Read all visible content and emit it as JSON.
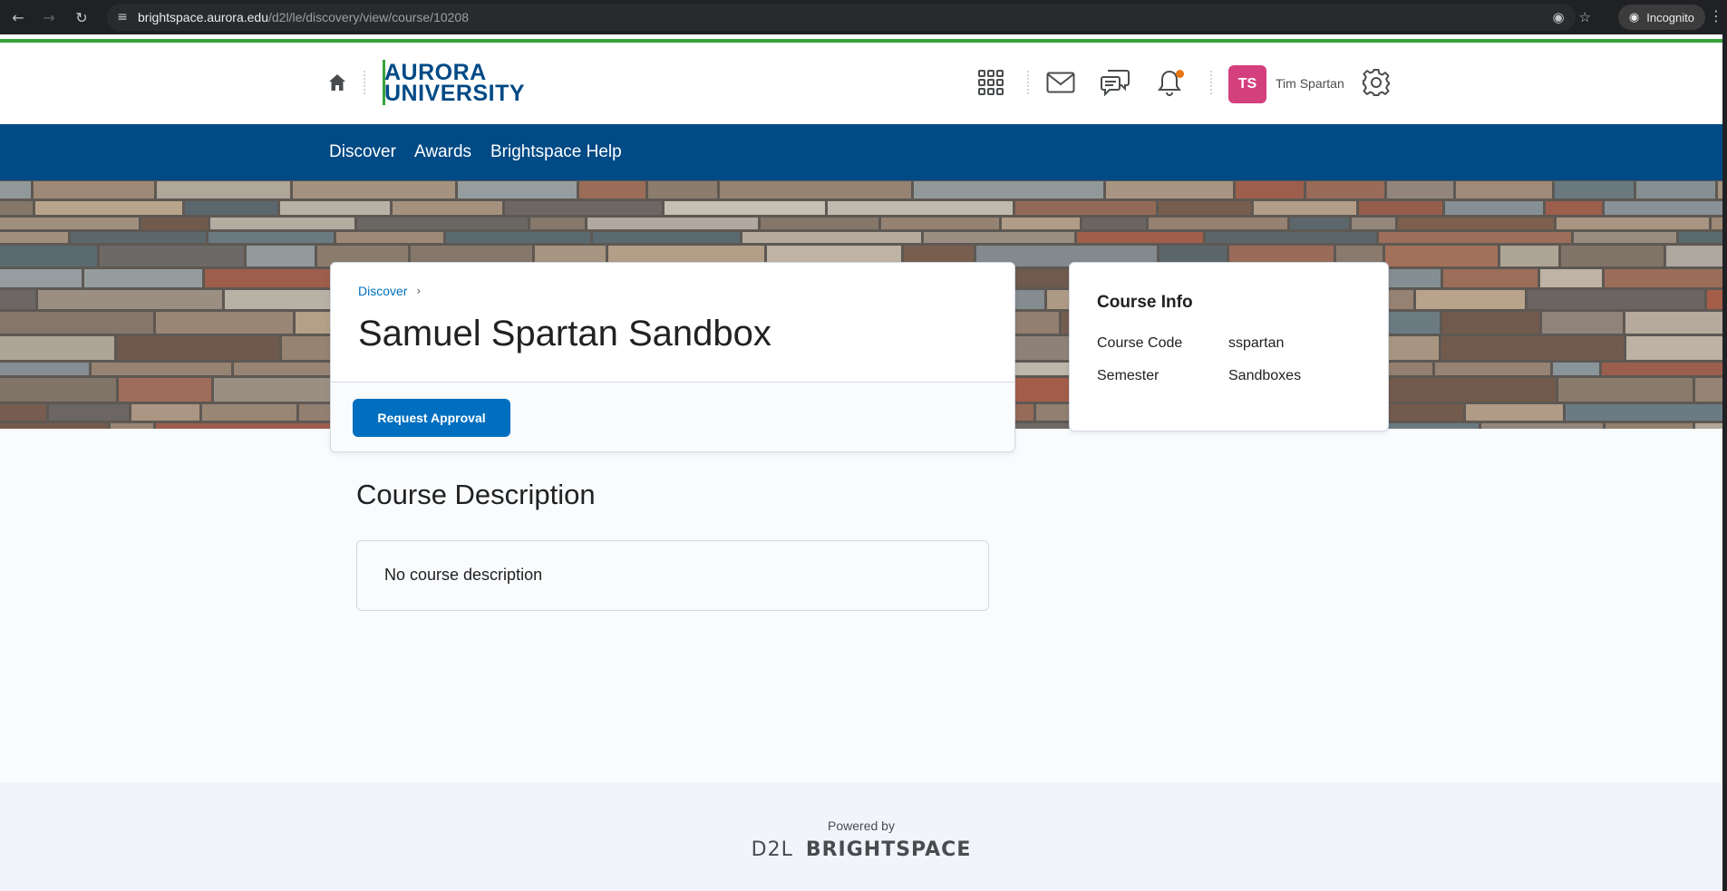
{
  "browser": {
    "url_host": "brightspace.aurora.edu",
    "url_path": "/d2l/le/discovery/view/course/10208",
    "incognito_label": "Incognito"
  },
  "header": {
    "logo_line1": "AURORA",
    "logo_line2": "UNIVERSITY",
    "avatar_initials": "TS",
    "user_name": "Tim Spartan"
  },
  "navbar": {
    "items": [
      "Discover",
      "Awards",
      "Brightspace Help"
    ]
  },
  "course": {
    "breadcrumb": "Discover",
    "title": "Samuel Spartan Sandbox",
    "request_button": "Request Approval"
  },
  "course_info": {
    "heading": "Course Info",
    "rows": [
      {
        "label": "Course Code",
        "value": "sspartan"
      },
      {
        "label": "Semester",
        "value": "Sandboxes"
      }
    ]
  },
  "description": {
    "heading": "Course Description",
    "text": "No course description"
  },
  "footer": {
    "powered_by": "Powered by",
    "brand_d2l": "D2L",
    "brand_name": "BRIGHTSPACE"
  },
  "colors": {
    "primary_blue": "#004a85",
    "button_blue": "#006fbf",
    "brand_green": "#38a23a",
    "avatar_pink": "#d43f7e",
    "notification_orange": "#e87511"
  }
}
